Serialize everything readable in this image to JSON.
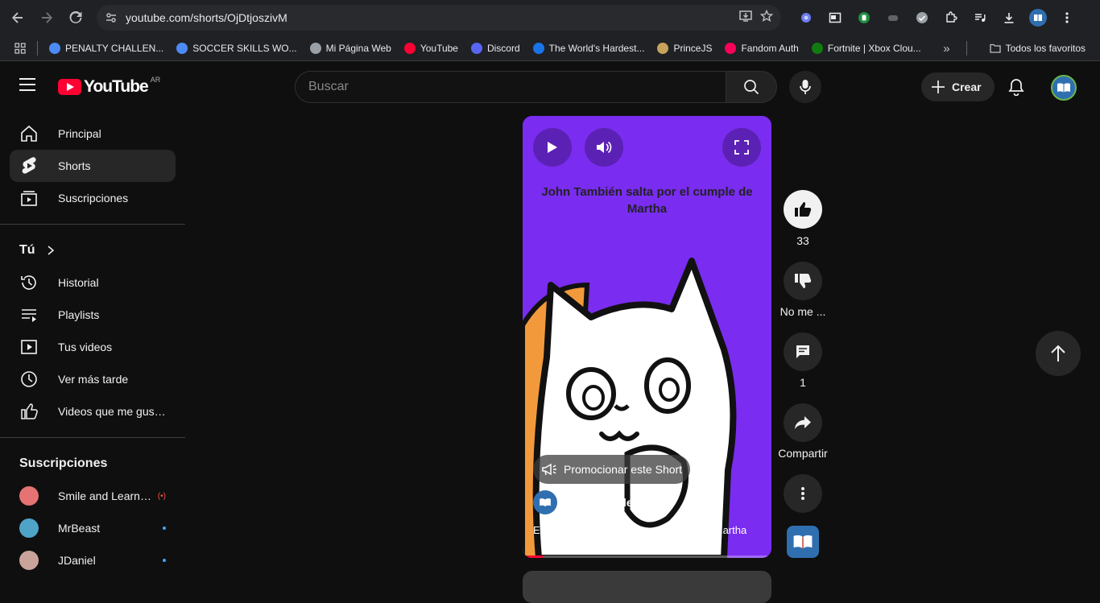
{
  "browser": {
    "url": "youtube.com/shorts/OjDtjoszivM",
    "bookmarks": [
      {
        "label": "PENALTY CHALLEN...",
        "color": "#4c8bf5"
      },
      {
        "label": "SOCCER SKILLS WO...",
        "color": "#4c8bf5"
      },
      {
        "label": "Mi Página Web",
        "color": "#9aa0a6"
      },
      {
        "label": "YouTube",
        "color": "#ff0033"
      },
      {
        "label": "Discord",
        "color": "#5865f2"
      },
      {
        "label": "The World's Hardest...",
        "color": "#1a73e8"
      },
      {
        "label": "PrinceJS",
        "color": "#c7a25c"
      },
      {
        "label": "Fandom Auth",
        "color": "#fa005a"
      },
      {
        "label": "Fortnite | Xbox Clou...",
        "color": "#107c10"
      }
    ],
    "all_bookmarks": "Todos los favoritos"
  },
  "header": {
    "logo_text": "YouTube",
    "country": "AR",
    "search_placeholder": "Buscar",
    "create_label": "Crear"
  },
  "sidebar": {
    "main": [
      {
        "label": "Principal",
        "icon": "home-icon"
      },
      {
        "label": "Shorts",
        "icon": "shorts-icon"
      },
      {
        "label": "Suscripciones",
        "icon": "subscriptions-icon"
      }
    ],
    "you_heading": "Tú",
    "you": [
      {
        "label": "Historial",
        "icon": "history-icon"
      },
      {
        "label": "Playlists",
        "icon": "playlists-icon"
      },
      {
        "label": "Tus videos",
        "icon": "your-videos-icon"
      },
      {
        "label": "Ver más tarde",
        "icon": "watch-later-icon"
      },
      {
        "label": "Videos que me gust...",
        "icon": "liked-videos-icon"
      }
    ],
    "subs_heading": "Suscripciones",
    "subscriptions": [
      {
        "label": "Smile and Learn -...",
        "color": "#e57373",
        "status": "live"
      },
      {
        "label": "MrBeast",
        "color": "#4fa3c7",
        "status": "new"
      },
      {
        "label": "JDaniel",
        "color": "#c9a39a",
        "status": "new"
      }
    ]
  },
  "short": {
    "caption": "John También salta por el cumple de Martha",
    "promote_label": "Promocionar este Short",
    "channel": "@Mundo_de_libros",
    "description": "El día que John saltó por el cumple de Martha",
    "progress_fraction": 0.08
  },
  "actions": {
    "likes": "33",
    "dislike_label": "No me ...",
    "comments": "1",
    "share_label": "Compartir"
  }
}
